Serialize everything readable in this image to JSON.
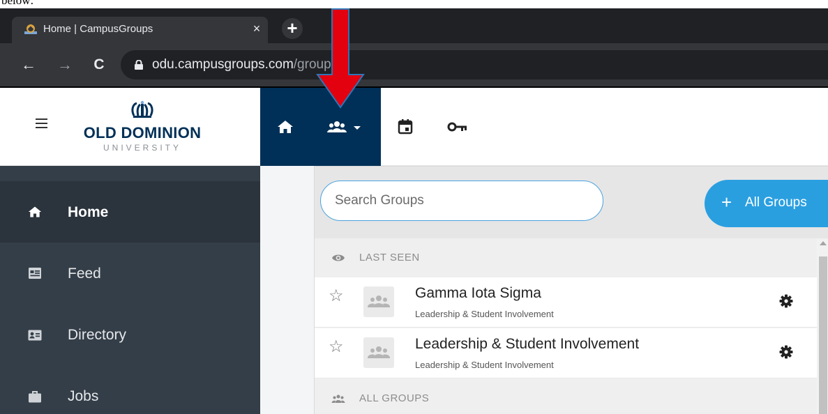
{
  "caption": "below:",
  "browser": {
    "tab_title": "Home | CampusGroups",
    "tab_close": "×",
    "new_tab": "+",
    "back": "←",
    "forward": "→",
    "reload": "C",
    "url_host": "odu.campusgroups.com",
    "url_path": "/groups"
  },
  "header": {
    "logo_name": "OLD DOMINION",
    "logo_sub": "UNIVERSITY",
    "brand_color": "#003057",
    "nav_icons": [
      "home-icon",
      "groups-icon",
      "calendar-icon",
      "key-icon"
    ]
  },
  "sidebar": {
    "items": [
      {
        "label": "Home",
        "icon": "home-icon",
        "active": true
      },
      {
        "label": "Feed",
        "icon": "feed-icon",
        "active": false
      },
      {
        "label": "Directory",
        "icon": "directory-icon",
        "active": false
      },
      {
        "label": "Jobs",
        "icon": "briefcase-icon",
        "active": false
      }
    ]
  },
  "groups_menu": {
    "search_placeholder": "Search Groups",
    "all_groups_plus": "+",
    "all_groups_label": "All Groups",
    "accent": "#2a9fe0",
    "last_seen_label": "LAST SEEN",
    "all_groups_section_label": "ALL GROUPS",
    "items": [
      {
        "name": "Gamma Iota Sigma",
        "category": "Leadership & Student Involvement",
        "star": "☆"
      },
      {
        "name": "Leadership & Student Involvement",
        "category": "Leadership & Student Involvement",
        "star": "☆"
      }
    ]
  },
  "annotation": {
    "color": "#e3000f",
    "outline": "#2e75b6"
  }
}
